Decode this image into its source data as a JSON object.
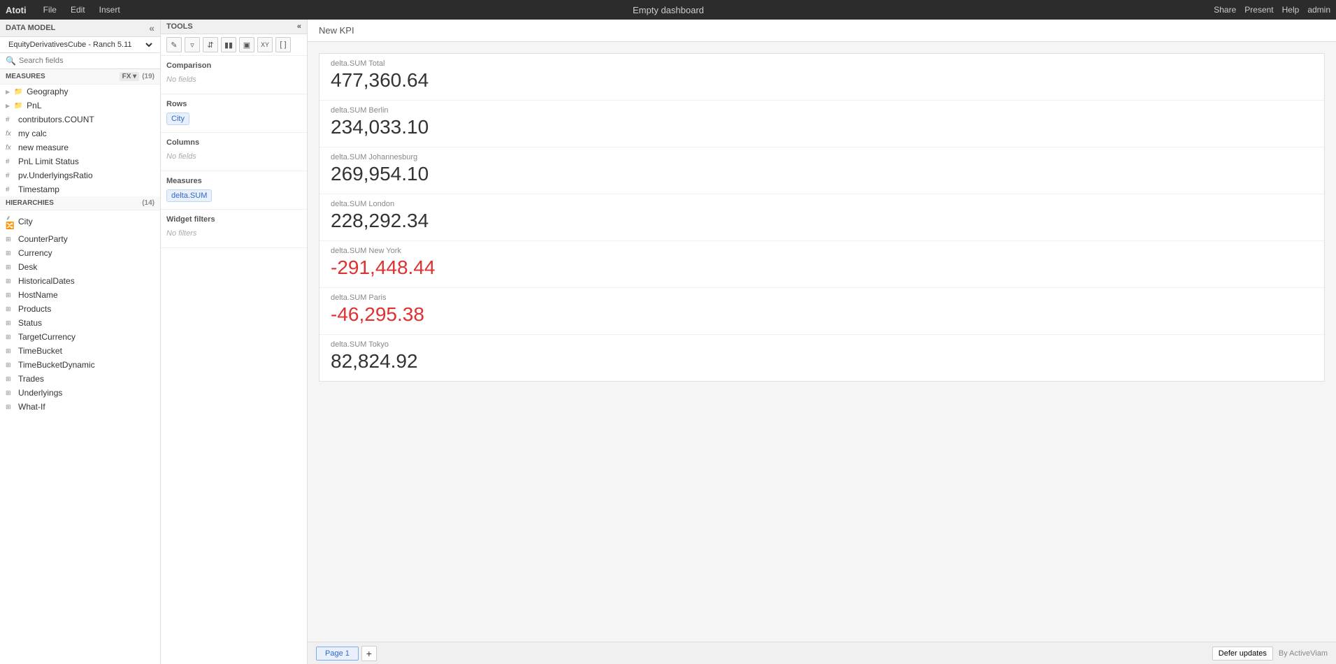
{
  "app": {
    "name": "Atoti",
    "menu": [
      "File",
      "Edit",
      "Insert"
    ],
    "title": "Empty dashboard",
    "right_actions": [
      "Share",
      "Present",
      "Help",
      "admin"
    ]
  },
  "data_model": {
    "header": "DATA MODEL",
    "cube": "EquityDerivativesCube - Ranch 5.11",
    "search_placeholder": "Search fields"
  },
  "measures": {
    "header": "MEASURES",
    "count": "(19)",
    "items": [
      {
        "type": "folder",
        "label": "Geography"
      },
      {
        "type": "folder",
        "label": "PnL"
      },
      {
        "type": "hash",
        "label": "contributors.COUNT"
      },
      {
        "type": "fx",
        "label": "my calc"
      },
      {
        "type": "fx",
        "label": "new measure"
      },
      {
        "type": "hash",
        "label": "PnL Limit Status"
      },
      {
        "type": "hash",
        "label": "pv.UnderlyingsRatio"
      },
      {
        "type": "hash",
        "label": "Timestamp"
      }
    ]
  },
  "hierarchies": {
    "header": "HIERARCHIES",
    "count": "(14)",
    "items": [
      "City",
      "CounterParty",
      "Currency",
      "Desk",
      "HistoricalDates",
      "HostName",
      "Products",
      "Status",
      "TargetCurrency",
      "TimeBucket",
      "TimeBucketDynamic",
      "Trades",
      "Underlyings",
      "What-If"
    ]
  },
  "tools": {
    "header": "TOOLS",
    "toolbar": [
      "pencil",
      "filter",
      "sort",
      "bars",
      "grid",
      "xy",
      "bracket"
    ],
    "comparison": {
      "label": "Comparison",
      "content": "No fields"
    },
    "rows": {
      "label": "Rows",
      "field": "City"
    },
    "columns": {
      "label": "Columns",
      "content": "No fields"
    },
    "measures": {
      "label": "Measures",
      "field": "delta.SUM"
    },
    "widget_filters": {
      "label": "Widget filters",
      "content": "No filters"
    }
  },
  "kpi": {
    "title": "New KPI",
    "items": [
      {
        "label": "delta.SUM Total",
        "value": "477,360.64",
        "negative": false
      },
      {
        "label": "delta.SUM Berlin",
        "value": "234,033.10",
        "negative": false
      },
      {
        "label": "delta.SUM Johannesburg",
        "value": "269,954.10",
        "negative": false
      },
      {
        "label": "delta.SUM London",
        "value": "228,292.34",
        "negative": false
      },
      {
        "label": "delta.SUM New York",
        "value": "-291,448.44",
        "negative": true
      },
      {
        "label": "delta.SUM Paris",
        "value": "-46,295.38",
        "negative": true
      },
      {
        "label": "delta.SUM Tokyo",
        "value": "82,824.92",
        "negative": false
      }
    ]
  },
  "bottom": {
    "page_tab": "Page 1",
    "add_page": "+",
    "defer_updates": "Defer updates",
    "by": "By ActiveViam"
  }
}
